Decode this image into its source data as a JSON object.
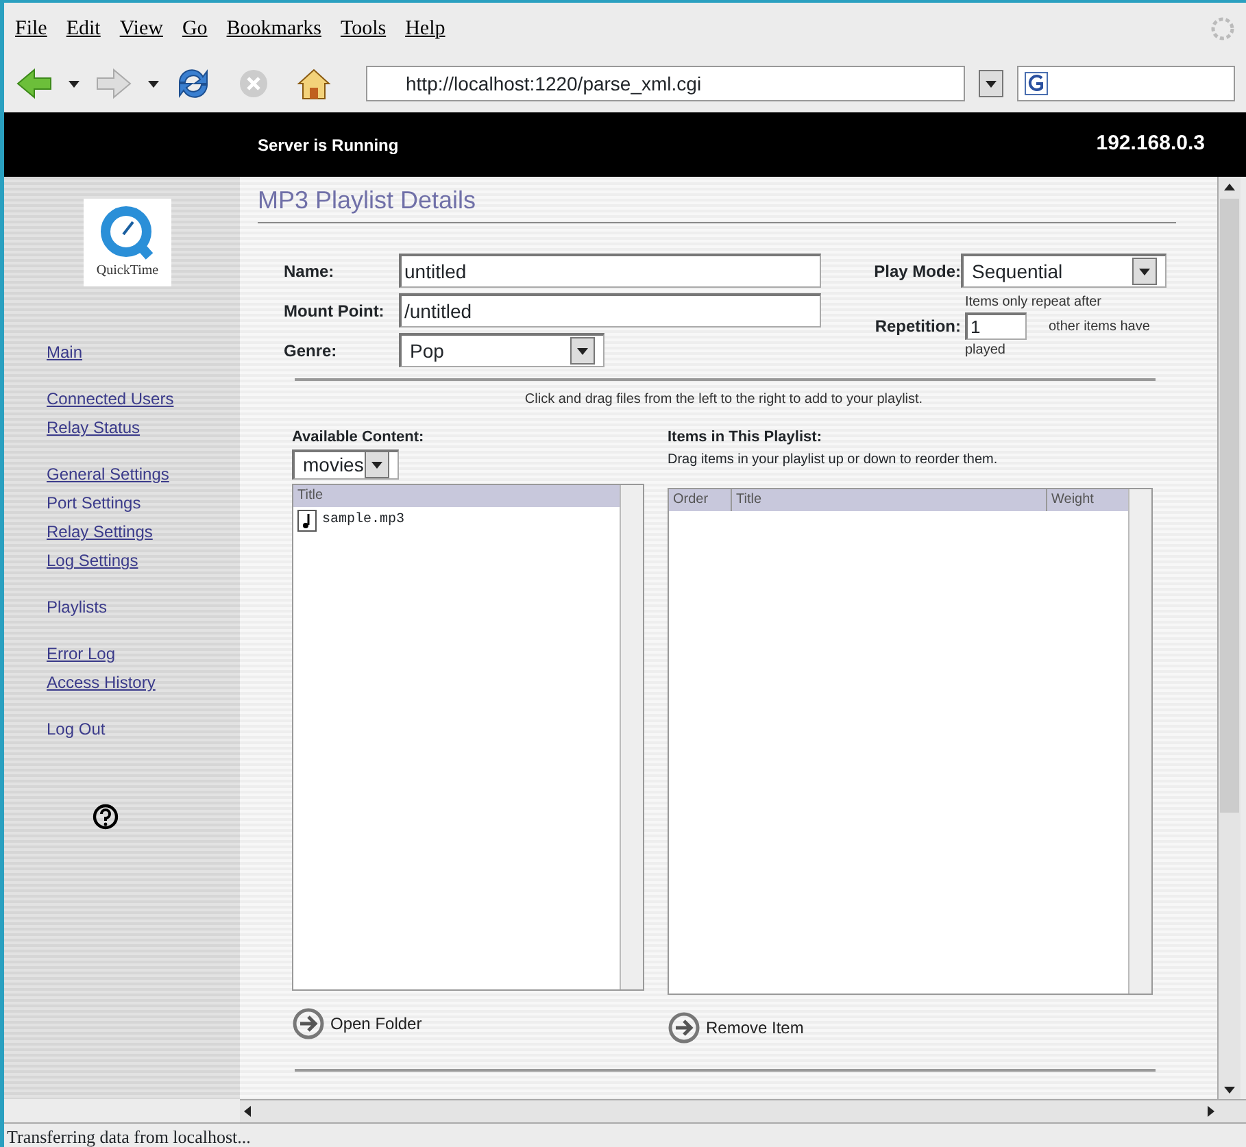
{
  "menu": [
    "File",
    "Edit",
    "View",
    "Go",
    "Bookmarks",
    "Tools",
    "Help"
  ],
  "toolbar": {
    "url": "http://localhost:1220/parse_xml.cgi"
  },
  "header": {
    "status": "Server is Running",
    "address": "192.168.0.3"
  },
  "sidebar": {
    "logo_caption": "QuickTime",
    "groups": [
      [
        {
          "label": "Main",
          "underlined": true
        }
      ],
      [
        {
          "label": "Connected Users",
          "underlined": true
        },
        {
          "label": "Relay Status",
          "underlined": true
        }
      ],
      [
        {
          "label": "General Settings",
          "underlined": true
        },
        {
          "label": "Port Settings",
          "underlined": false
        },
        {
          "label": "Relay Settings",
          "underlined": true
        },
        {
          "label": "Log Settings",
          "underlined": true
        }
      ],
      [
        {
          "label": "Playlists",
          "underlined": false
        }
      ],
      [
        {
          "label": "Error Log",
          "underlined": true
        },
        {
          "label": "Access History",
          "underlined": true
        }
      ],
      [
        {
          "label": "Log Out",
          "underlined": false
        }
      ]
    ]
  },
  "page": {
    "title": "MP3 Playlist Details",
    "name": {
      "label": "Name:",
      "value": "untitled"
    },
    "mount_point": {
      "label": "Mount Point:",
      "value": "/untitled"
    },
    "genre": {
      "label": "Genre:",
      "value": "Pop"
    },
    "play_mode": {
      "label": "Play Mode:",
      "value": "Sequential"
    },
    "repetition": {
      "label": "Repetition:",
      "before": "Items only repeat after",
      "value": "1",
      "after": "other items have",
      "after_2": "played"
    },
    "hint": "Click and drag files from the left to the right to add to your playlist.",
    "available": {
      "label": "Available Content:",
      "folder": "movies",
      "columns": [
        "Title"
      ],
      "rows": [
        {
          "title": "sample.mp3"
        }
      ],
      "button": "Open Folder"
    },
    "playlist": {
      "label": "Items in This Playlist:",
      "hint": "Drag items in your playlist up or down to reorder them.",
      "columns": [
        "Order",
        "Title",
        "Weight"
      ],
      "button": "Remove Item"
    }
  },
  "status_bar": "Transferring data from localhost..."
}
